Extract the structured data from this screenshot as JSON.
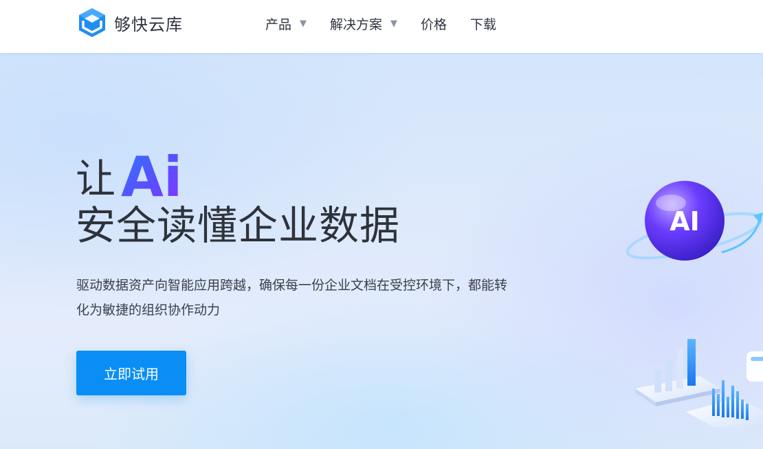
{
  "header": {
    "logo_text": "够快云库",
    "nav": [
      {
        "label": "产品",
        "has_caret": true
      },
      {
        "label": "解决方案",
        "has_caret": true
      },
      {
        "label": "价格",
        "has_caret": false
      },
      {
        "label": "下载",
        "has_caret": false
      }
    ],
    "caret_glyph": "▼"
  },
  "hero": {
    "title_prefix": "让",
    "title_ai": "Ai",
    "title_line2": "安全读懂企业数据",
    "description": "驱动数据资产向智能应用跨越，确保每一份企业文档在受控环境下，都能转化为敏捷的组织协作动力",
    "cta_label": "立即试用",
    "illustration_badge": "AI"
  },
  "colors": {
    "brand_blue": "#0a8ef5",
    "logo_blue": "#1f8ef1",
    "ai_gradient_start": "#2f7bff",
    "ai_gradient_end": "#8a33ff"
  },
  "icons": {
    "logo": "cube-logo-icon",
    "dropdown": "chevron-down-icon"
  }
}
